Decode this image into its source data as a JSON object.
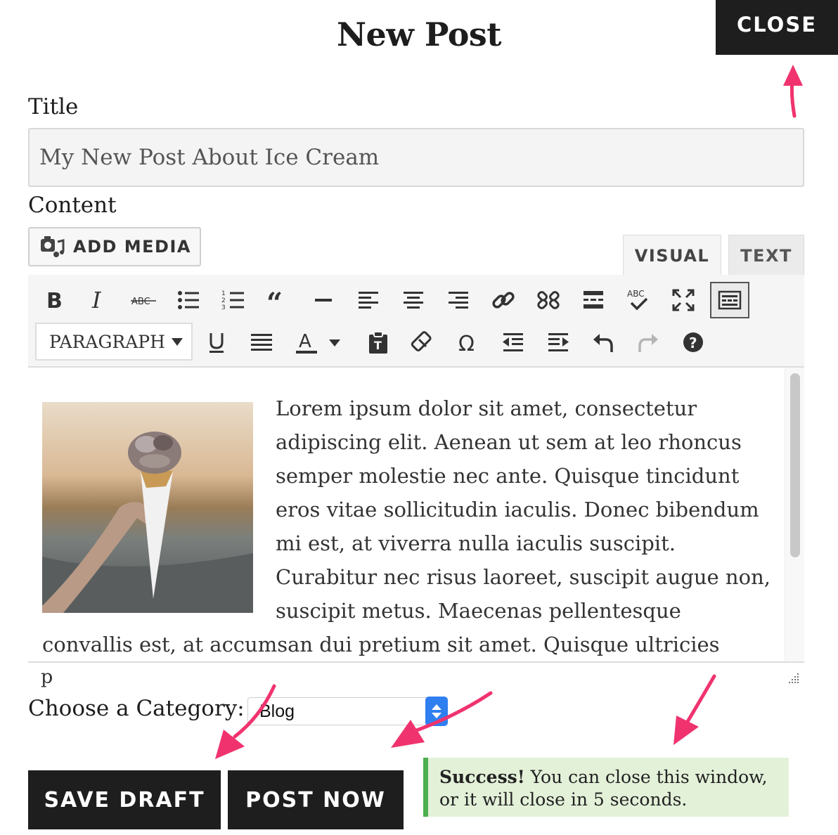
{
  "header": {
    "title": "New Post",
    "close_label": "CLOSE"
  },
  "form": {
    "title_label": "Title",
    "title_value": "My New Post About Ice Cream",
    "content_label": "Content",
    "add_media_label": "ADD MEDIA",
    "tabs": {
      "visual": "VISUAL",
      "text": "TEXT"
    },
    "format_select": "PARAGRAPH",
    "toolbar_icons": [
      "bold-icon",
      "italic-icon",
      "strikethrough-icon",
      "bullet-list-icon",
      "numbered-list-icon",
      "blockquote-icon",
      "horizontal-rule-icon",
      "align-left-icon",
      "align-center-icon",
      "align-right-icon",
      "link-icon",
      "unlink-icon",
      "read-more-icon",
      "spellcheck-icon",
      "fullscreen-icon",
      "kitchen-sink-icon",
      "underline-icon",
      "justify-icon",
      "text-color-icon",
      "paste-text-icon",
      "clear-formatting-icon",
      "special-character-icon",
      "outdent-icon",
      "indent-icon",
      "undo-icon",
      "redo-icon",
      "help-icon"
    ],
    "body_text": "Lorem ipsum dolor sit amet, consectetur adipiscing elit. Aenean ut sem at leo rhoncus semper molestie nec ante. Quisque tincidunt eros vitae sollicitudin iaculis. Donec bibendum mi est, at viverra nulla iaculis suscipit. Curabitur nec risus laoreet, suscipit augue non, suscipit metus. Maecenas pellentesque convallis est, at accumsan dui pretium sit amet. Quisque ultricies sapien a laoreet commodo.",
    "status_path": "p",
    "category_label": "Choose a Category:",
    "category_value": "Blog"
  },
  "actions": {
    "save_draft": "SAVE DRAFT",
    "post_now": "POST NOW"
  },
  "notice": {
    "strong": "Success!",
    "line1": " You can close this window,",
    "line2": "or it will close in 5 seconds."
  },
  "colors": {
    "dark_button": "#1e1e1e",
    "arrow": "#f0336e",
    "notice_bg": "#e3f1d9",
    "notice_border": "#4caf50",
    "select_accent": "#2f7ff0"
  }
}
